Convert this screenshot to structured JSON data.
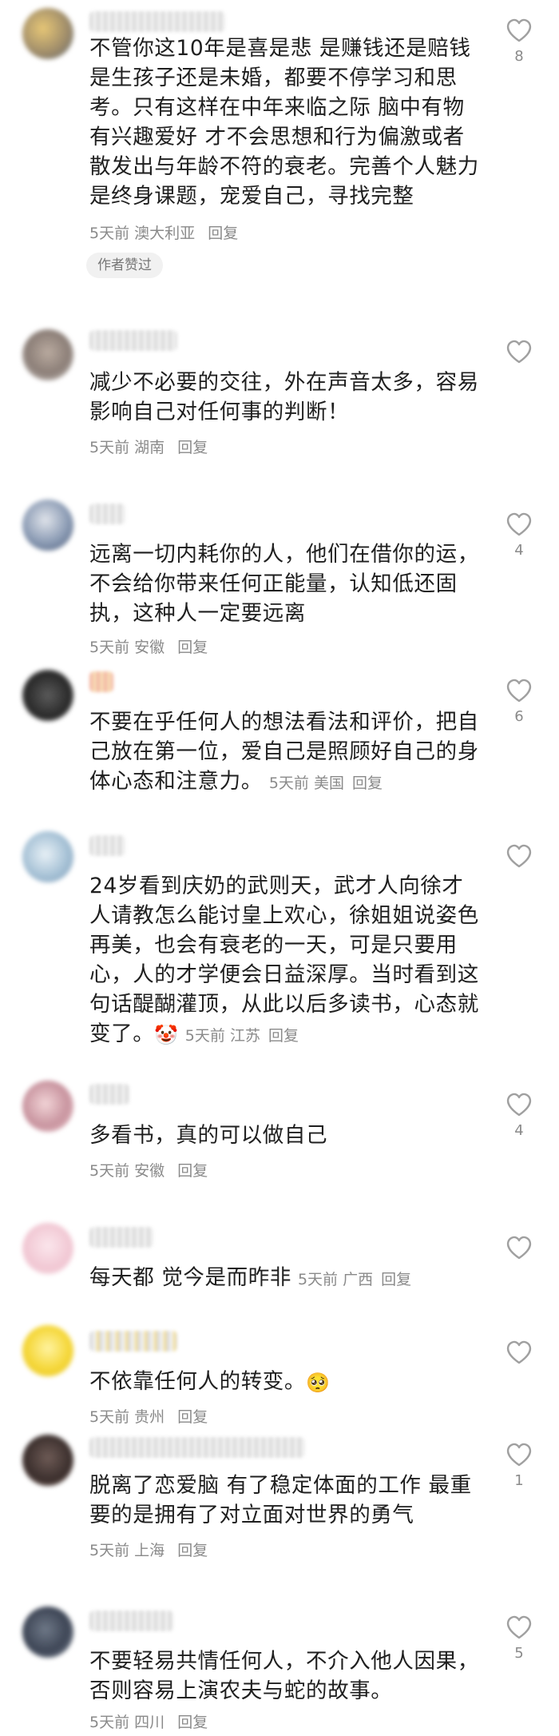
{
  "comments": [
    {
      "text": "不管你这10年是喜是悲 是赚钱还是赔钱是生孩子还是未婚，都要不停学习和思考。只有这样在中年来临之际 脑中有物有兴趣爱好 才不会思想和行为偏激或者散发出与年龄不符的衰老。完善个人魅力是终身课题，宠爱自己，寻找完整",
      "time": "5天前",
      "location": "澳大利亚",
      "reply": "回复",
      "likes": "8",
      "badge": "作者赞过"
    },
    {
      "text": "减少不必要的交往，外在声音太多，容易影响自己对任何事的判断！",
      "time": "5天前",
      "location": "湖南",
      "reply": "回复",
      "likes": ""
    },
    {
      "text": "远离一切内耗你的人，他们在借你的运，不会给你带来任何正能量，认知低还固执，这种人一定要远离",
      "time": "5天前",
      "location": "安徽",
      "reply": "回复",
      "likes": "4"
    },
    {
      "text": "不要在乎任何人的想法看法和评价，把自己放在第一位，爱自己是照顾好自己的身体心态和注意力。",
      "time": "5天前",
      "location": "美国",
      "reply": "回复",
      "likes": "6"
    },
    {
      "text": "24岁看到庆奶的武则天，武才人向徐才人请教怎么能讨皇上欢心，徐姐姐说姿色再美，也会有衰老的一天，可是只要用心，人的才学便会日益深厚。当时看到这句话醍醐灌顶，从此以后多读书，心态就变了。",
      "emoji": "🤡",
      "time": "5天前",
      "location": "江苏",
      "reply": "回复",
      "likes": ""
    },
    {
      "text": "多看书，真的可以做自己",
      "time": "5天前",
      "location": "安徽",
      "reply": "回复",
      "likes": "4"
    },
    {
      "text": "每天都 觉今是而昨非",
      "time": "5天前",
      "location": "广西",
      "reply": "回复",
      "likes": ""
    },
    {
      "text": "不依靠任何人的转变。",
      "emoji": "🥺",
      "time": "5天前",
      "location": "贵州",
      "reply": "回复",
      "likes": ""
    },
    {
      "text": "脱离了恋爱脑 有了稳定体面的工作 最重要的是拥有了对立面对世界的勇气",
      "time": "5天前",
      "location": "上海",
      "reply": "回复",
      "likes": "1"
    },
    {
      "text": "不要轻易共情任何人，不介入他人因果，否则容易上演农夫与蛇的故事。",
      "time": "5天前",
      "location": "四川",
      "reply": "回复",
      "likes": "5"
    }
  ],
  "icons": {
    "like": "heart-outline-icon"
  },
  "colors": {
    "text": "#1f1f1f",
    "meta": "#8a8a8a",
    "badge_bg": "#f1f1f1"
  }
}
